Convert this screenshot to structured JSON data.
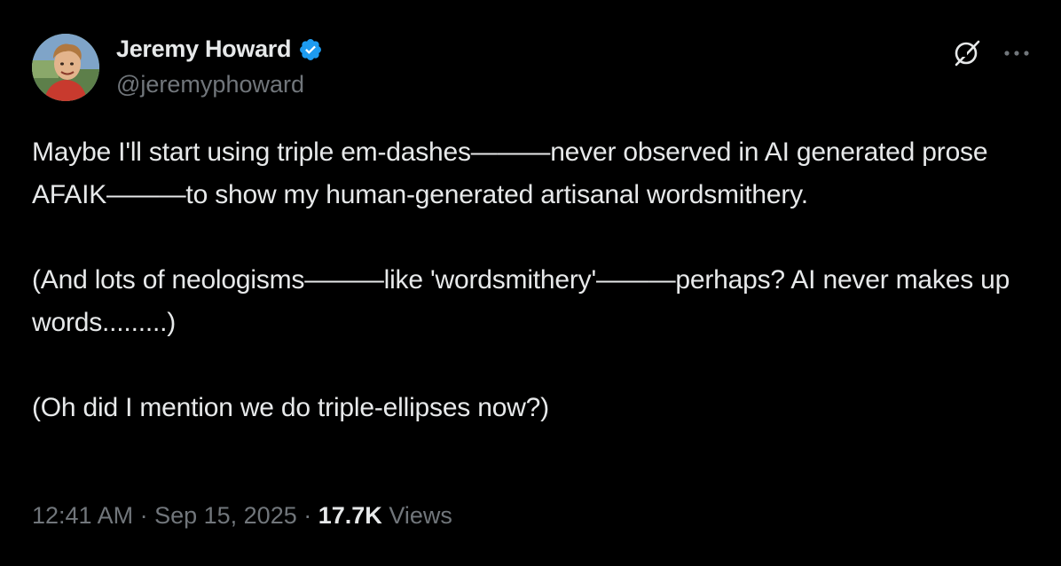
{
  "author": {
    "display_name": "Jeremy Howard",
    "handle": "@jeremyphoward",
    "verified_icon": "verified-badge-icon",
    "verified_color": "#1d9bf0"
  },
  "header_icons": {
    "grok": "grok-icon",
    "more": "more-options-icon"
  },
  "post": {
    "paragraphs": [
      "Maybe I'll start using triple em-dashes———never observed in AI generated prose AFAIK———to show my human-generated artisanal wordsmithery.",
      "(And lots of neologisms———like 'wordsmithery'———perhaps? AI never makes up words.........)",
      "(Oh did I mention we do triple-ellipses now?)"
    ]
  },
  "meta": {
    "time": "12:41 AM",
    "separator": " · ",
    "date": "Sep 15, 2025",
    "views_count": "17.7K",
    "views_label": "Views"
  },
  "colors": {
    "background": "#000000",
    "primary_text": "#e7e9ea",
    "secondary_text": "#71767b"
  }
}
